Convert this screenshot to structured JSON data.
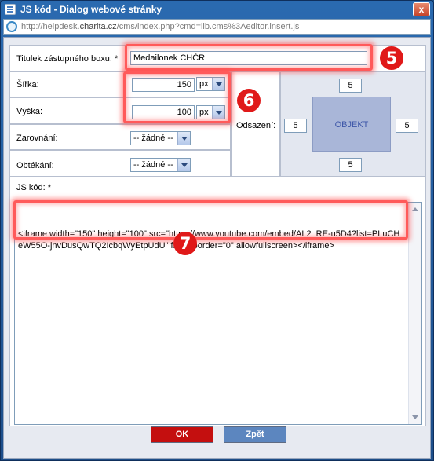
{
  "window": {
    "title": "JS kód - Dialog webové stránky",
    "close_label": "x"
  },
  "urlbar": {
    "prefix": "http://helpdesk.",
    "domain": "charita.cz",
    "suffix": "/cms/index.php?cmd=lib.cms%3Aeditor.insert.js"
  },
  "form": {
    "title_label": "Titulek zástupného boxu: *",
    "title_value": "Medailonek CHČR",
    "width_label": "Šířka:",
    "width_value": "150",
    "width_unit": "px",
    "height_label": "Výška:",
    "height_value": "100",
    "height_unit": "px",
    "align_label": "Zarovnání:",
    "align_value": "-- žádné --",
    "wrap_label": "Obtékání:",
    "wrap_value": "-- žádné --",
    "margin_label": "Odsazení:",
    "margin_top": "5",
    "margin_left": "5",
    "margin_right": "5",
    "margin_bottom": "5",
    "object_label": "OBJEKT",
    "js_label": "JS kód: *",
    "js_code": "<iframe width=\"150\" height=\"100\" src=\"https://www.youtube.com/embed/AL2_RE-u5D4?list=PLuCHeW55O-jnvDusQwTQ2IcbqWyEtpUdU\" frameborder=\"0\" allowfullscreen></iframe>"
  },
  "buttons": {
    "ok": "OK",
    "back": "Zpět"
  },
  "annotations": {
    "badge_5": "5",
    "badge_6": "6",
    "badge_7": "7"
  },
  "colors": {
    "highlight": "#ff5a5a",
    "badge": "#e01919",
    "ok_button": "#c40f0f",
    "back_button": "#5c86bf"
  }
}
